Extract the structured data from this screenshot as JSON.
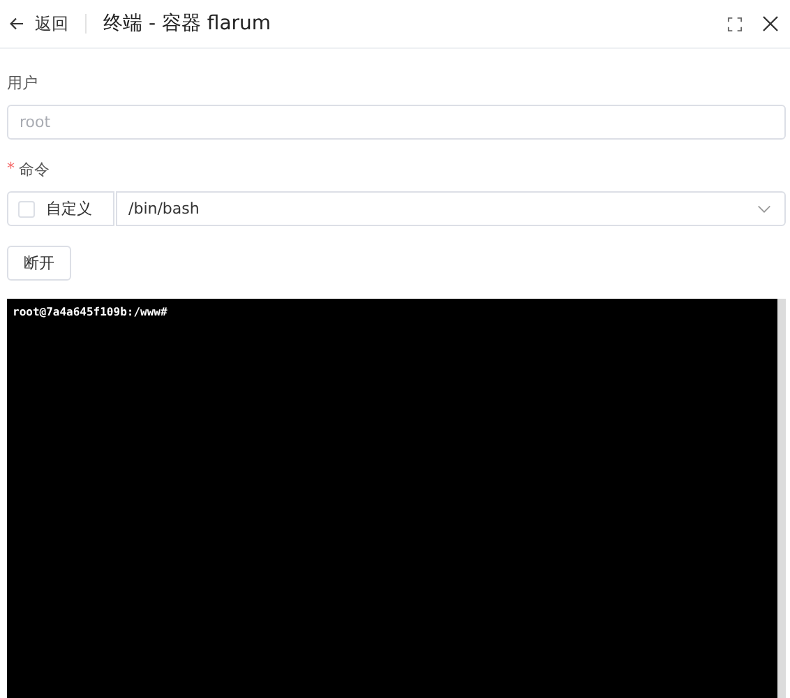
{
  "header": {
    "back_label": "返回",
    "title": "终端 - 容器 flarum"
  },
  "form": {
    "user": {
      "label": "用户",
      "placeholder": "root"
    },
    "command": {
      "label": "命令",
      "required_mark": "*",
      "custom": {
        "label": "自定义",
        "checked": false
      },
      "value": "/bin/bash"
    },
    "button": "断开"
  },
  "terminal": {
    "lines": [
      "root@7a4a645f109b:/www#"
    ]
  }
}
